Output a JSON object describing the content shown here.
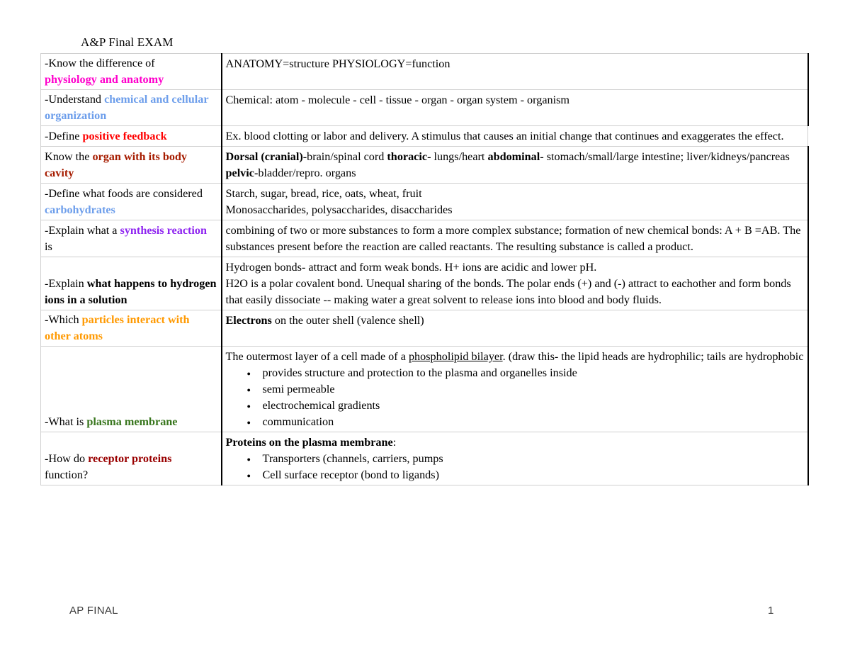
{
  "document": {
    "title": "A&P Final EXAM",
    "footer_left": "AP FINAL",
    "page_number": "1"
  },
  "colors": {
    "magenta": "#ff00cc",
    "blue": "#6d9eeb",
    "red": "#ff0000",
    "brick": "#a61c00",
    "purple": "#8e24f0",
    "orange": "#ff9900",
    "green": "#38761d",
    "dark_red": "#990000",
    "divider_black": "#000000",
    "row_line_gray": "#cfcfcf"
  },
  "rows": [
    {
      "id": "physiology-anatomy",
      "question_plain_1": "-Know the difference of ",
      "question_highlight": "physiology and anatomy",
      "answer_line_1": "ANATOMY=structure  PHYSIOLOGY=function"
    },
    {
      "id": "chemical-cellular-organization",
      "question_plain_1": "-Understand ",
      "question_highlight": "chemical and cellular organization",
      "answer_line_1": "Chemical: atom - molecule - cell - tissue - organ - organ system - organism"
    },
    {
      "id": "positive-feedback",
      "question_plain_1": "-Define ",
      "question_highlight": "positive feedback",
      "answer_line_1": "Ex. blood clotting or labor and delivery. A stimulus that causes an initial change that continues and exaggerates the effect."
    },
    {
      "id": "organ-body-cavity",
      "question_plain_1": "Know the ",
      "question_highlight": "organ with its body cavity",
      "answer_bold_1": "Dorsal (cranial)",
      "answer_text_1": "-brain/spinal cord ",
      "answer_bold_2": "thoracic",
      "answer_text_2": "- lungs/heart ",
      "answer_bold_3": "abdominal",
      "answer_text_3": "- stomach/small/large intestine; liver/kidneys/pancreas ",
      "answer_bold_4": "pelvic-",
      "answer_text_4": "bladder/repro. organs"
    },
    {
      "id": "carbohydrates",
      "question_plain_1": "-Define what foods are considered ",
      "question_highlight": "carbohydrates",
      "answer_line_1": "Starch, sugar, bread, rice, oats, wheat, fruit",
      "answer_line_2": "Monosaccharides, polysaccharides, disaccharides"
    },
    {
      "id": "synthesis-reaction",
      "question_plain_1": "-Explain what a ",
      "question_highlight": "synthesis reaction",
      "question_plain_2": " is",
      "answer_line_1": "combining of two or more substances to form a more complex substance; formation of new chemical bonds: A + B =AB. The substances present before the reaction are called reactants. The resulting substance is called a product."
    },
    {
      "id": "hydrogen-ions",
      "question_plain_1": "-Explain ",
      "question_highlight": "what happens to hydrogen ions in a solution",
      "answer_line_1": "Hydrogen bonds- attract and form weak bonds. H+ ions are acidic and lower pH.",
      "answer_line_2": "H2O is a polar covalent bond. Unequal sharing of the bonds. The polar ends (+) and (-) attract to eachother and form bonds that easily dissociate -- making water a great solvent to release ions into blood and body fluids."
    },
    {
      "id": "particles-interact",
      "question_plain_1": "-Which ",
      "question_highlight": "particles interact with other atoms",
      "answer_bold_1": "Electrons",
      "answer_text_1": " on the outer shell (valence shell)"
    },
    {
      "id": "plasma-membrane",
      "question_plain_1": "-What is ",
      "question_highlight": "plasma membrane",
      "answer_text_pre": "The outermost layer of a cell made of a ",
      "answer_underlined": "phospholipid bilayer",
      "answer_text_post": ". (draw this- the lipid heads are hydrophilic; tails are hydrophobic",
      "answer_bullets": [
        "provides structure and protection to the plasma and organelles inside",
        "semi permeable",
        "electrochemical gradients",
        "communication"
      ]
    },
    {
      "id": "receptor-proteins",
      "question_plain_1": "-How do ",
      "question_highlight": "receptor proteins",
      "question_plain_2": "function?",
      "answer_bold_1": "Proteins on the plasma membrane",
      "answer_text_1": ":",
      "answer_bullets": [
        "Transporters (channels, carriers, pumps",
        "Cell surface receptor (bond to ligands)"
      ]
    }
  ]
}
